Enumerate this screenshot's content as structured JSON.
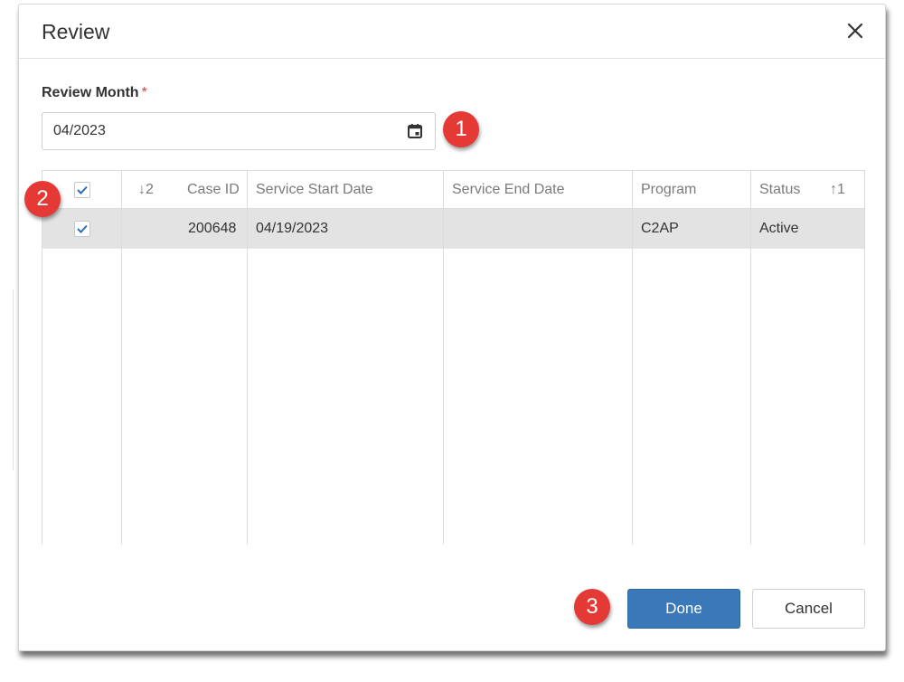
{
  "dialog": {
    "title": "Review",
    "close_label": "×"
  },
  "review_month": {
    "label": "Review Month",
    "required_mark": "*",
    "value": "04/2023"
  },
  "grid": {
    "sort_indicators": {
      "case_id": "↓2",
      "status": "↑1"
    },
    "columns": [
      "Case ID",
      "Service Start Date",
      "Service End Date",
      "Program",
      "Status"
    ],
    "header_checked": true,
    "rows": [
      {
        "checked": true,
        "case_id": "200648",
        "service_start_date": "04/19/2023",
        "service_end_date": "",
        "program": "C2AP",
        "status": "Active"
      }
    ]
  },
  "buttons": {
    "done": "Done",
    "cancel": "Cancel"
  },
  "annotations": [
    "1",
    "2",
    "3"
  ],
  "colors": {
    "primary": "#3a78b8",
    "required": "#d9363e",
    "marker": "#e53935",
    "selected_row": "#e3e3e3"
  }
}
